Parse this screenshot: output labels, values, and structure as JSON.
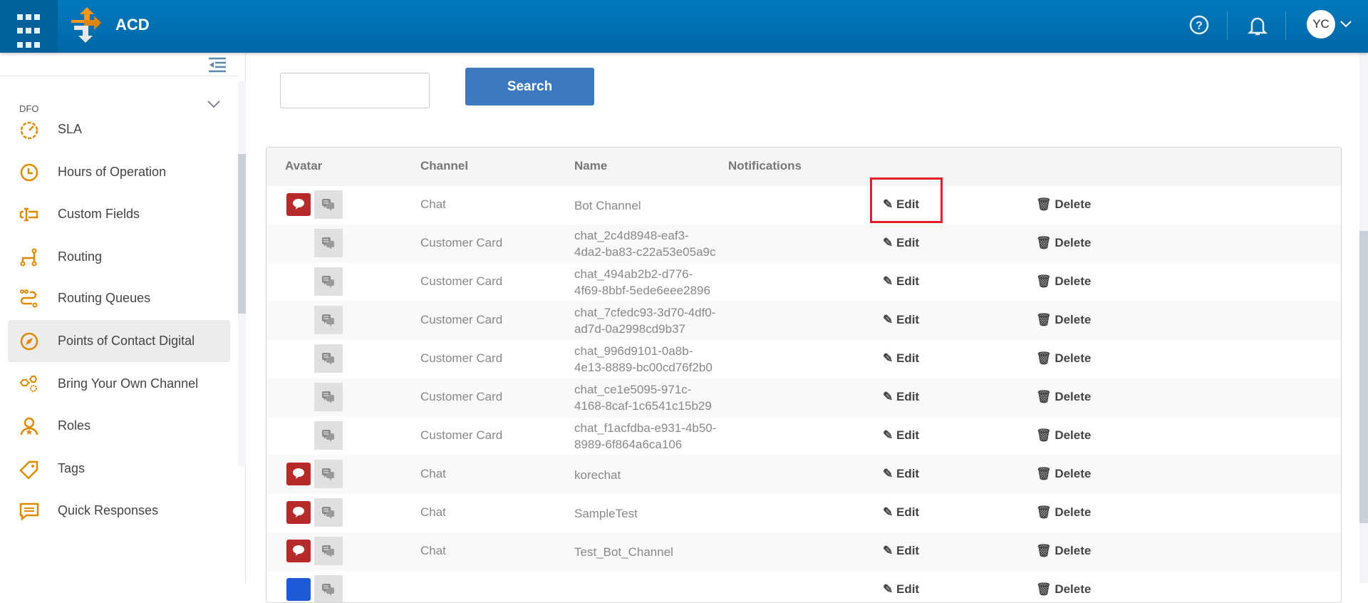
{
  "header": {
    "app_title": "ACD",
    "user_initials": "YC"
  },
  "sidebar": {
    "section": "DFO",
    "items": [
      {
        "label": "SLA",
        "icon": "speedometer-icon"
      },
      {
        "label": "Hours of Operation",
        "icon": "clock-icon"
      },
      {
        "label": "Custom Fields",
        "icon": "custom-fields-icon"
      },
      {
        "label": "Routing",
        "icon": "routing-icon"
      },
      {
        "label": "Routing Queues",
        "icon": "routing-queues-icon"
      },
      {
        "label": "Points of Contact Digital",
        "icon": "compass-icon",
        "active": true
      },
      {
        "label": "Bring Your Own Channel",
        "icon": "byoc-icon"
      },
      {
        "label": "Roles",
        "icon": "roles-icon"
      },
      {
        "label": "Tags",
        "icon": "tag-icon"
      },
      {
        "label": "Quick Responses",
        "icon": "quick-responses-icon"
      }
    ]
  },
  "search": {
    "value": "",
    "button": "Search"
  },
  "table": {
    "headers": [
      "Avatar",
      "Channel",
      "Name",
      "Notifications"
    ],
    "edit_label": "Edit",
    "delete_label": "Delete",
    "rows": [
      {
        "avatar": "red",
        "channel": "Chat",
        "name": [
          "Bot Channel"
        ]
      },
      {
        "avatar": "none",
        "channel": "Customer Card",
        "name": [
          "chat_2c4d8948-eaf3-",
          "4da2-ba83-c22a53e05a9c"
        ]
      },
      {
        "avatar": "none",
        "channel": "Customer Card",
        "name": [
          "chat_494ab2b2-d776-",
          "4f69-8bbf-5ede6eee2896"
        ]
      },
      {
        "avatar": "none",
        "channel": "Customer Card",
        "name": [
          "chat_7cfedc93-3d70-4df0-",
          "ad7d-0a2998cd9b37"
        ]
      },
      {
        "avatar": "none",
        "channel": "Customer Card",
        "name": [
          "chat_996d9101-0a8b-",
          "4e13-8889-bc00cd76f2b0"
        ]
      },
      {
        "avatar": "none",
        "channel": "Customer Card",
        "name": [
          "chat_ce1e5095-971c-",
          "4168-8caf-1c6541c15b29"
        ]
      },
      {
        "avatar": "none",
        "channel": "Customer Card",
        "name": [
          "chat_f1acfdba-e931-4b50-",
          "8989-6f864a6ca106"
        ]
      },
      {
        "avatar": "red",
        "channel": "Chat",
        "name": [
          "korechat"
        ]
      },
      {
        "avatar": "red",
        "channel": "Chat",
        "name": [
          "SampleTest"
        ]
      },
      {
        "avatar": "red",
        "channel": "Chat",
        "name": [
          "Test_Bot_Channel"
        ]
      },
      {
        "avatar": "blue",
        "channel": "",
        "name": [
          ""
        ]
      }
    ]
  },
  "colors": {
    "header": "#0073b5",
    "accent": "#e08a00",
    "search_button": "#3b78bf",
    "highlight": "#e31e24",
    "chat_avatar": "#b72a2a"
  }
}
